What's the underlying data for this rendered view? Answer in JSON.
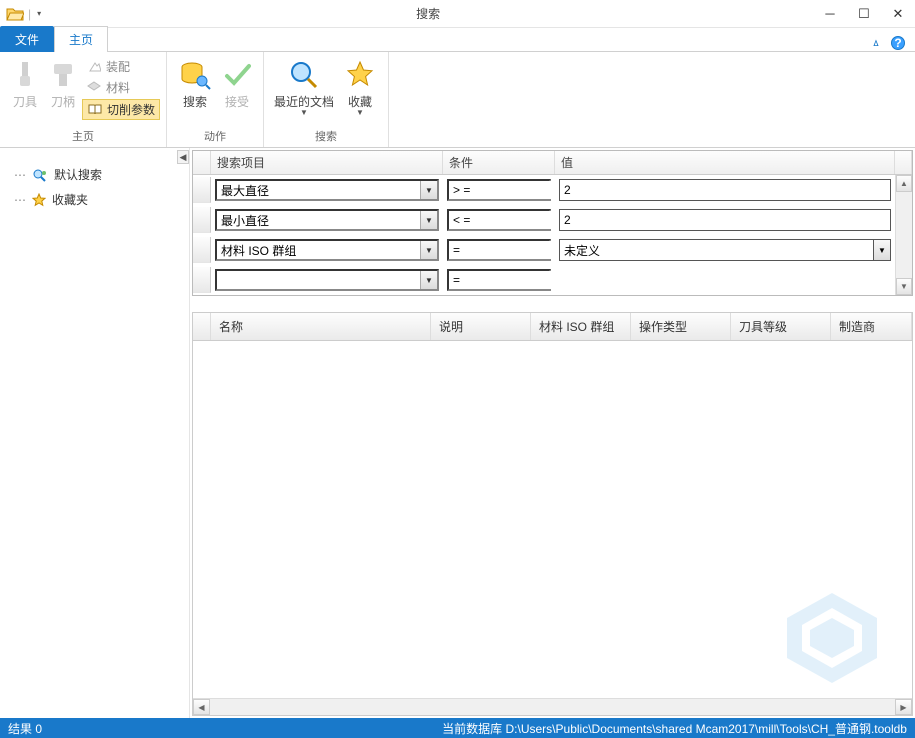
{
  "title": "搜索",
  "tabs": {
    "file": "文件",
    "home": "主页"
  },
  "ribbon": {
    "group_home": {
      "label": "主页",
      "tool": "刀具",
      "holder": "刀柄",
      "assembly": "装配",
      "material": "材料",
      "cutparams": "切削参数"
    },
    "group_action": {
      "label": "动作",
      "search": "搜索",
      "accept": "接受"
    },
    "group_search": {
      "label": "搜索",
      "recent": "最近的文档",
      "fav": "收藏"
    }
  },
  "tree": {
    "default_search": "默认搜索",
    "favorites": "收藏夹"
  },
  "criteria": {
    "headers": {
      "item": "搜索项目",
      "cond": "条件",
      "value": "值"
    },
    "rows": [
      {
        "item": "最大直径",
        "cond": "> =",
        "value": "2"
      },
      {
        "item": "最小直径",
        "cond": "< =",
        "value": "2"
      },
      {
        "item": "材料 ISO 群组",
        "cond": "=",
        "value": "未定义"
      },
      {
        "item": "",
        "cond": "=",
        "value": ""
      }
    ]
  },
  "results": {
    "columns": [
      "名称",
      "说明",
      "材料 ISO 群组",
      "操作类型",
      "刀具等级",
      "制造商"
    ]
  },
  "status": {
    "left": "结果 0",
    "right": "当前数据库 D:\\Users\\Public\\Documents\\shared Mcam2017\\mill\\Tools\\CH_普通钢.tooldb"
  }
}
